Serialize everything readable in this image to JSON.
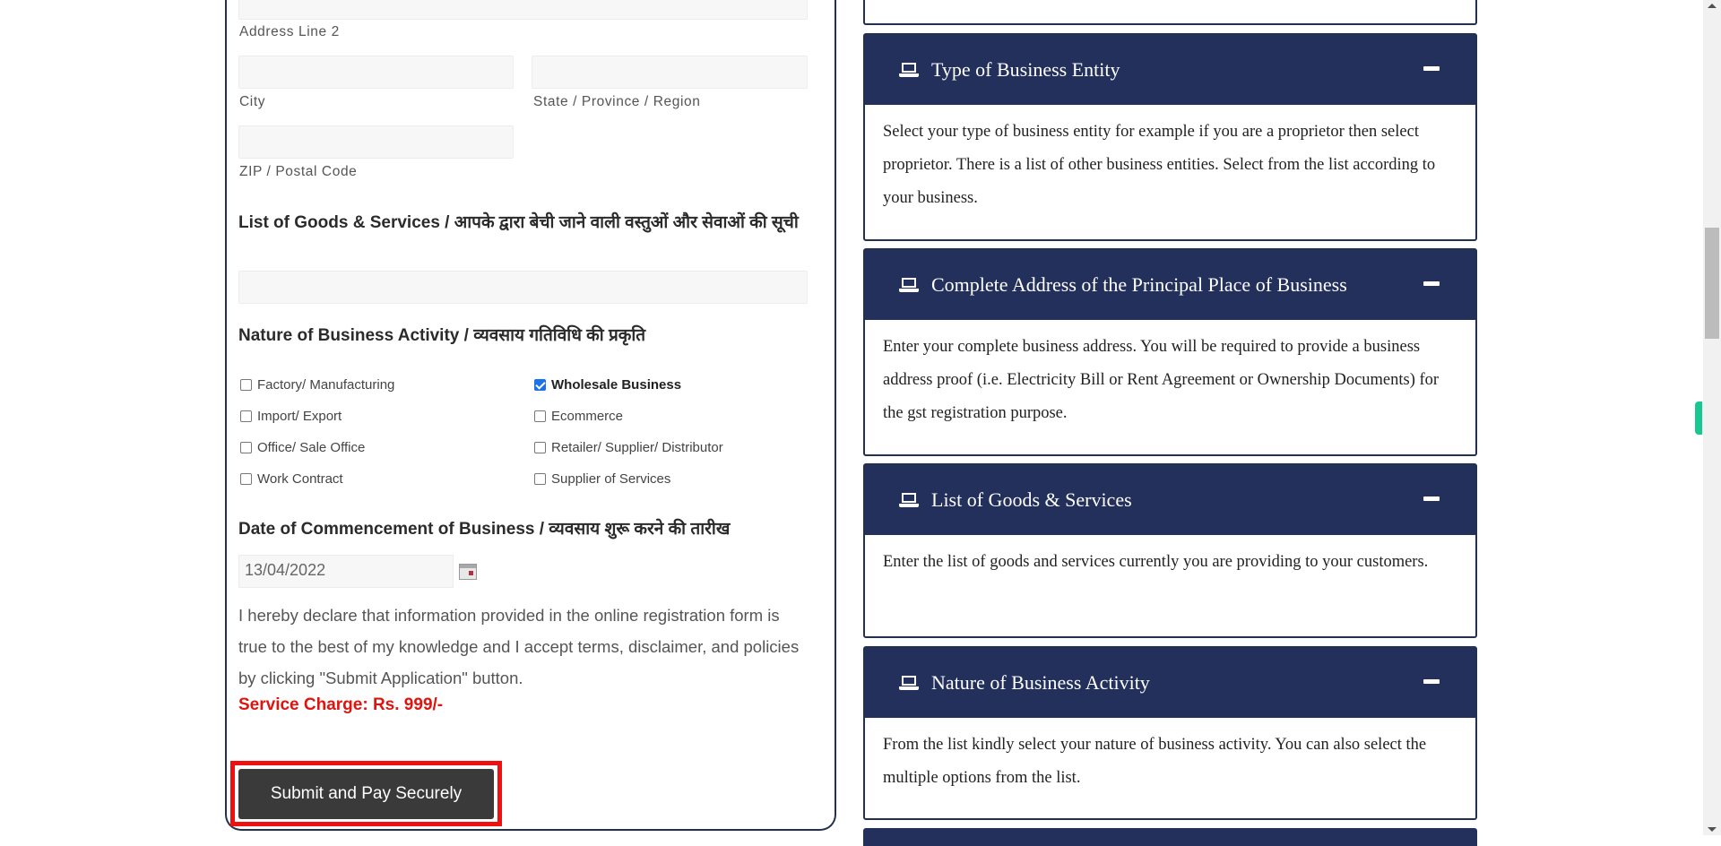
{
  "form": {
    "address_line2_label": "Address Line 2",
    "address_line2_value": "",
    "city_label": "City",
    "city_value": "",
    "state_label": "State / Province / Region",
    "state_value": "",
    "zip_label": "ZIP / Postal Code",
    "zip_value": "",
    "goods_heading": "List of Goods & Services / आपके द्वारा बेची जाने वाली वस्तुओं और सेवाओं की सूची",
    "goods_value": "",
    "nature_heading": "Nature of Business Activity / व्यवसाय गतिविधि की प्रकृति",
    "activities": [
      {
        "label": "Factory/ Manufacturing",
        "checked": false
      },
      {
        "label": "Wholesale Business",
        "checked": true
      },
      {
        "label": "Import/ Export",
        "checked": false
      },
      {
        "label": "Ecommerce",
        "checked": false
      },
      {
        "label": "Office/ Sale Office",
        "checked": false
      },
      {
        "label": "Retailer/ Supplier/ Distributor",
        "checked": false
      },
      {
        "label": "Work Contract",
        "checked": false
      },
      {
        "label": "Supplier of Services",
        "checked": false
      }
    ],
    "date_heading": "Date of Commencement of Business / व्यवसाय शुरू करने की तारीख",
    "date_value": "13/04/2022",
    "declaration": "I hereby declare that information provided in the online registration form is true to the best of my knowledge and I accept terms, disclaimer, and policies by clicking \"Submit Application\" button.",
    "service_charge": "Service Charge: Rs. 999/-",
    "submit_label": "Submit and Pay Securely"
  },
  "accordion": [
    {
      "icon": "laptop-icon",
      "title": "Type of Business Entity",
      "toggle": "minus",
      "body": "Select your type of business entity for example if you are a proprietor then select proprietor. There is a list of other business entities. Select from the list according to your business."
    },
    {
      "icon": "laptop-icon",
      "title": "Complete Address of the Principal Place of Business",
      "toggle": "minus",
      "body": "Enter your complete business address. You will be required to provide a business address proof (i.e. Electricity Bill or Rent Agreement or Ownership Documents) for the gst registration purpose."
    },
    {
      "icon": "laptop-icon",
      "title": "List of Goods & Services",
      "toggle": "minus",
      "body": "Enter the list of goods and services currently you are providing to your customers."
    },
    {
      "icon": "laptop-icon",
      "title": "Nature of Business Activity",
      "toggle": "minus",
      "body": "From the list kindly select your nature of business activity. You can also select the multiple options from the list."
    }
  ],
  "colors": {
    "accordion_header": "#22305b",
    "service_charge": "#e0140f",
    "submit_button": "#3a3a3a",
    "highlight": "#ee1111",
    "side_tab": "#17c990"
  }
}
